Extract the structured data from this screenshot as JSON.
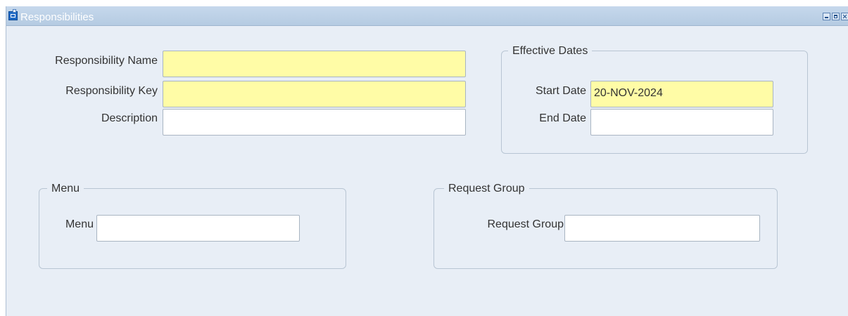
{
  "window": {
    "title": "Responsibilities"
  },
  "responsibility": {
    "name_label": "Responsibility Name",
    "name_value": "",
    "key_label": "Responsibility Key",
    "key_value": "",
    "description_label": "Description",
    "description_value": ""
  },
  "effective_dates": {
    "group_title": "Effective Dates",
    "start_label": "Start Date",
    "start_value": "20-NOV-2024",
    "end_label": "End Date",
    "end_value": ""
  },
  "menu": {
    "group_title": "Menu",
    "label": "Menu",
    "value": ""
  },
  "request_group": {
    "group_title": "Request Group",
    "label": "Request Group",
    "value": ""
  },
  "colors": {
    "required_field": "#fffca6",
    "window_background": "#e8eef6",
    "titlebar": "#b5cbe2"
  }
}
